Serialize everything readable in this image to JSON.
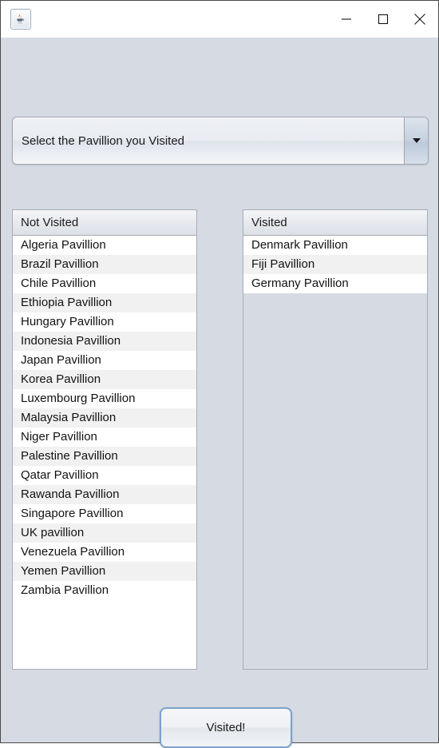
{
  "window": {
    "title": "",
    "app_icon": "java-coffee-cup-icon",
    "background_color": "#d6dae3",
    "titlebar_color": "#ffffff",
    "border_color": "#4a4a4a"
  },
  "titlebar": {
    "minimize_label": "—",
    "maximize_label": "□",
    "close_label": "×",
    "icons": [
      "minimize-icon",
      "maximize-icon",
      "close-icon"
    ]
  },
  "combo": {
    "selected": "Select the Pavillion you Visited",
    "arrow_icon": "chevron-down-icon"
  },
  "lists": {
    "not_visited": {
      "header": "Not Visited",
      "items": [
        "Algeria Pavillion",
        "Brazil Pavillion",
        "Chile Pavillion",
        "Ethiopia Pavillion",
        "Hungary Pavillion",
        "Indonesia Pavillion",
        "Japan Pavillion",
        "Korea Pavillion",
        "Luxembourg Pavillion",
        "Malaysia Pavillion",
        "Niger Pavillion",
        "Palestine Pavillion",
        "Qatar Pavillion",
        "Rawanda Pavillion",
        "Singapore Pavillion",
        "UK pavillion",
        "Venezuela Pavillion",
        "Yemen Pavillion",
        "Zambia Pavillion"
      ]
    },
    "visited": {
      "header": "Visited",
      "items": [
        "Denmark Pavillion",
        "Fiji Pavillion",
        "Germany Pavillion"
      ]
    }
  },
  "actions": {
    "visited_button": "Visited!"
  },
  "colors": {
    "panel_background": "#d6dae3",
    "row_even": "#ffffff",
    "row_odd": "#f1f1f1",
    "border": "#a6acb8",
    "button_focus_border": "#7ba2cc"
  }
}
